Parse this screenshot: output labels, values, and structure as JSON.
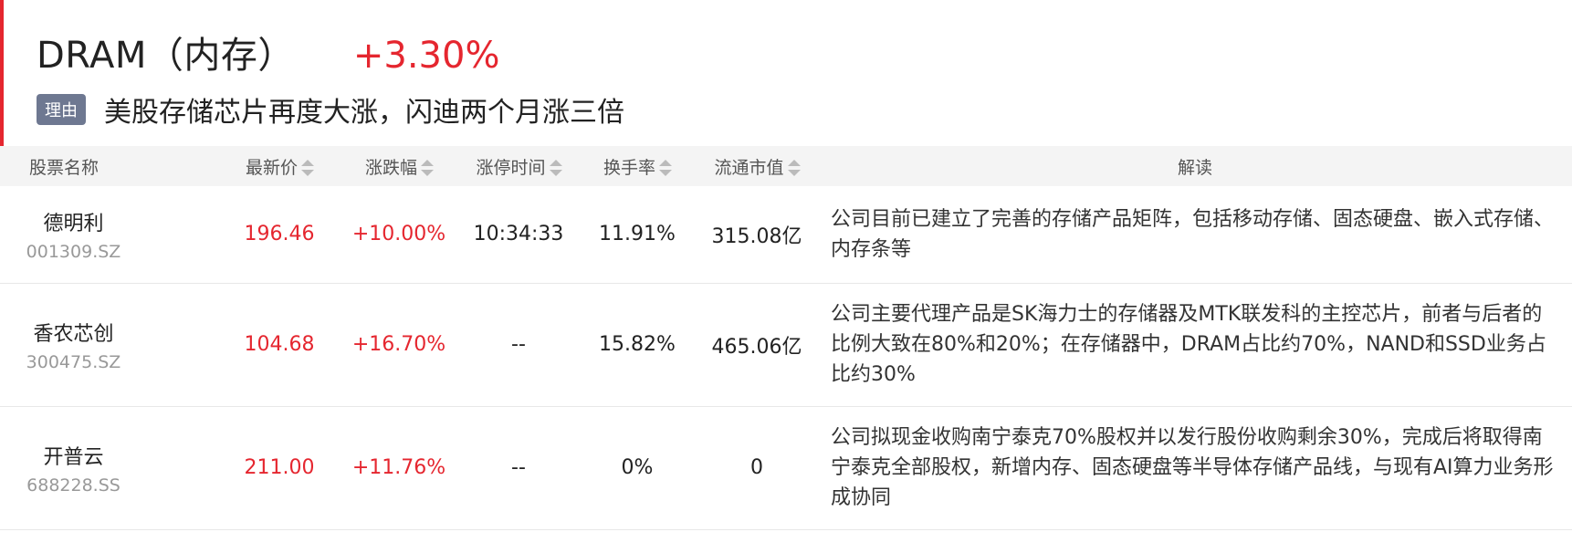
{
  "header": {
    "title": "DRAM（内存）",
    "change": "+3.30%",
    "reason_tag": "理由",
    "reason_text": "美股存储芯片再度大涨，闪迪两个月涨三倍"
  },
  "columns": {
    "name": "股票名称",
    "price": "最新价",
    "change": "涨跌幅",
    "limit_time": "涨停时间",
    "turnover": "换手率",
    "market_cap": "流通市值",
    "analysis": "解读"
  },
  "rows": [
    {
      "name": "德明利",
      "code": "001309.SZ",
      "price": "196.46",
      "change": "+10.00%",
      "limit_time": "10:34:33",
      "turnover": "11.91%",
      "market_cap": "315.08亿",
      "analysis": "公司目前已建立了完善的存储产品矩阵，包括移动存储、固态硬盘、嵌入式存储、内存条等"
    },
    {
      "name": "香农芯创",
      "code": "300475.SZ",
      "price": "104.68",
      "change": "+16.70%",
      "limit_time": "--",
      "turnover": "15.82%",
      "market_cap": "465.06亿",
      "analysis": "公司主要代理产品是SK海力士的存储器及MTK联发科的主控芯片，前者与后者的比例大致在80%和20%；在存储器中，DRAM占比约70%，NAND和SSD业务占比约30%"
    },
    {
      "name": "开普云",
      "code": "688228.SS",
      "price": "211.00",
      "change": "+11.76%",
      "limit_time": "--",
      "turnover": "0%",
      "market_cap": "0",
      "analysis": "公司拟现金收购南宁泰克70%股权并以发行股份收购剩余30%，完成后将取得南宁泰克全部股权，新增内存、固态硬盘等半导体存储产品线，与现有AI算力业务形成协同"
    }
  ],
  "colors": {
    "accent_red": "#e5262f",
    "tag_bg": "#6e7891"
  }
}
